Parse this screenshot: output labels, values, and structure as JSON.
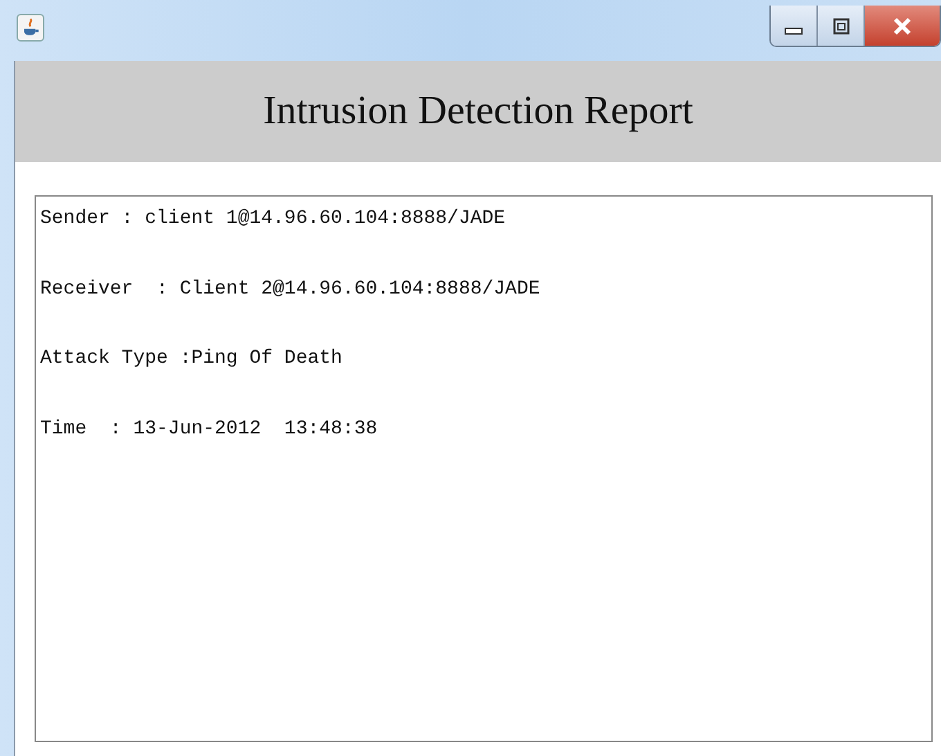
{
  "window": {
    "buttons": [
      {
        "kind": "minimize"
      },
      {
        "kind": "maximize"
      },
      {
        "kind": "close"
      }
    ]
  },
  "header": {
    "title": "Intrusion Detection Report"
  },
  "report": {
    "lines": [
      "Sender : client 1@14.96.60.104:8888/JADE",
      "Receiver  : Client 2@14.96.60.104:8888/JADE",
      "Attack Type :Ping Of Death",
      "Time  : 13-Jun-2012  13:48:38"
    ]
  }
}
